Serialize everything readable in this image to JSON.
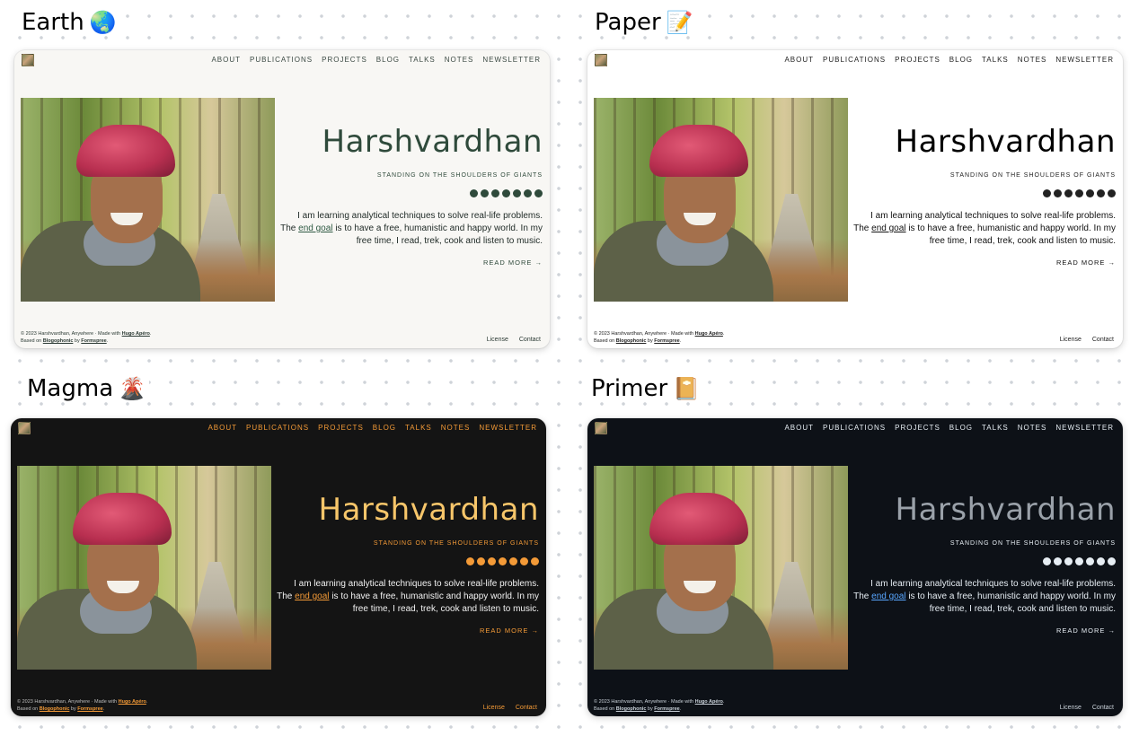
{
  "site": {
    "nav": [
      "About",
      "Publications",
      "Projects",
      "Blog",
      "Talks",
      "Notes",
      "Newsletter"
    ],
    "hero": {
      "name": "Harshvardhan",
      "tagline": "Standing on the shoulders of giants",
      "bio_pre": "I am learning analytical techniques to solve real-life problems. The",
      "bio_link": "end goal",
      "bio_post": "is to have a free, humanistic and happy world. In my free time, I read, trek, cook and listen to music.",
      "read_more": "Read More →"
    },
    "social_icons": [
      "github-icon",
      "linkedin-icon",
      "twitter-icon",
      "orcid-icon",
      "scholar-icon",
      "spotify-icon",
      "rss-icon"
    ],
    "footer": {
      "copyright": "© 2023 Harshvardhan, Anywhere",
      "separator": " · ",
      "made_with": "Made with",
      "hugo_link": "Hugo Apéro",
      "based_on": "Based on",
      "blogophonic": "Blogophonic",
      "by": "by",
      "formspree": "Formspree",
      "license": "License",
      "contact": "Contact"
    }
  },
  "themes": [
    {
      "title": "Earth",
      "emoji": "🌏",
      "accent": "#2f4a3b",
      "background": "#f8f7f4"
    },
    {
      "title": "Paper",
      "emoji": "📝",
      "accent": "#000000",
      "background": "#ffffff"
    },
    {
      "title": "Magma",
      "emoji": "🌋",
      "accent": "#f39a37",
      "background": "#141414"
    },
    {
      "title": "Primer",
      "emoji": "📔",
      "accent": "#58a6ff",
      "background": "#0d1117"
    }
  ]
}
